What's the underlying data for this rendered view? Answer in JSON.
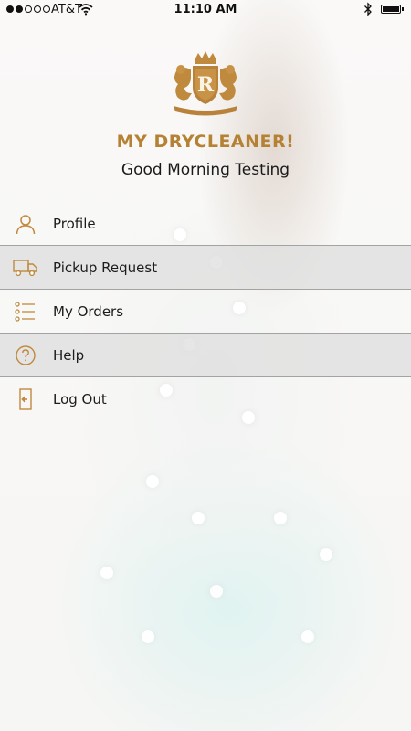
{
  "status_bar": {
    "carrier": "AT&T",
    "time": "11:10 AM"
  },
  "header": {
    "crest_letter": "R",
    "brand": "MY DRYCLEANER!",
    "greeting": "Good Morning Testing"
  },
  "menu": {
    "items": [
      {
        "label": "Profile",
        "icon": "person-icon"
      },
      {
        "label": "Pickup Request",
        "icon": "truck-icon"
      },
      {
        "label": "My Orders",
        "icon": "list-icon"
      },
      {
        "label": "Help",
        "icon": "question-icon"
      },
      {
        "label": "Log Out",
        "icon": "logout-icon"
      }
    ]
  },
  "colors": {
    "accent_gold": "#b58134",
    "icon_gold": "#c08a3e"
  }
}
